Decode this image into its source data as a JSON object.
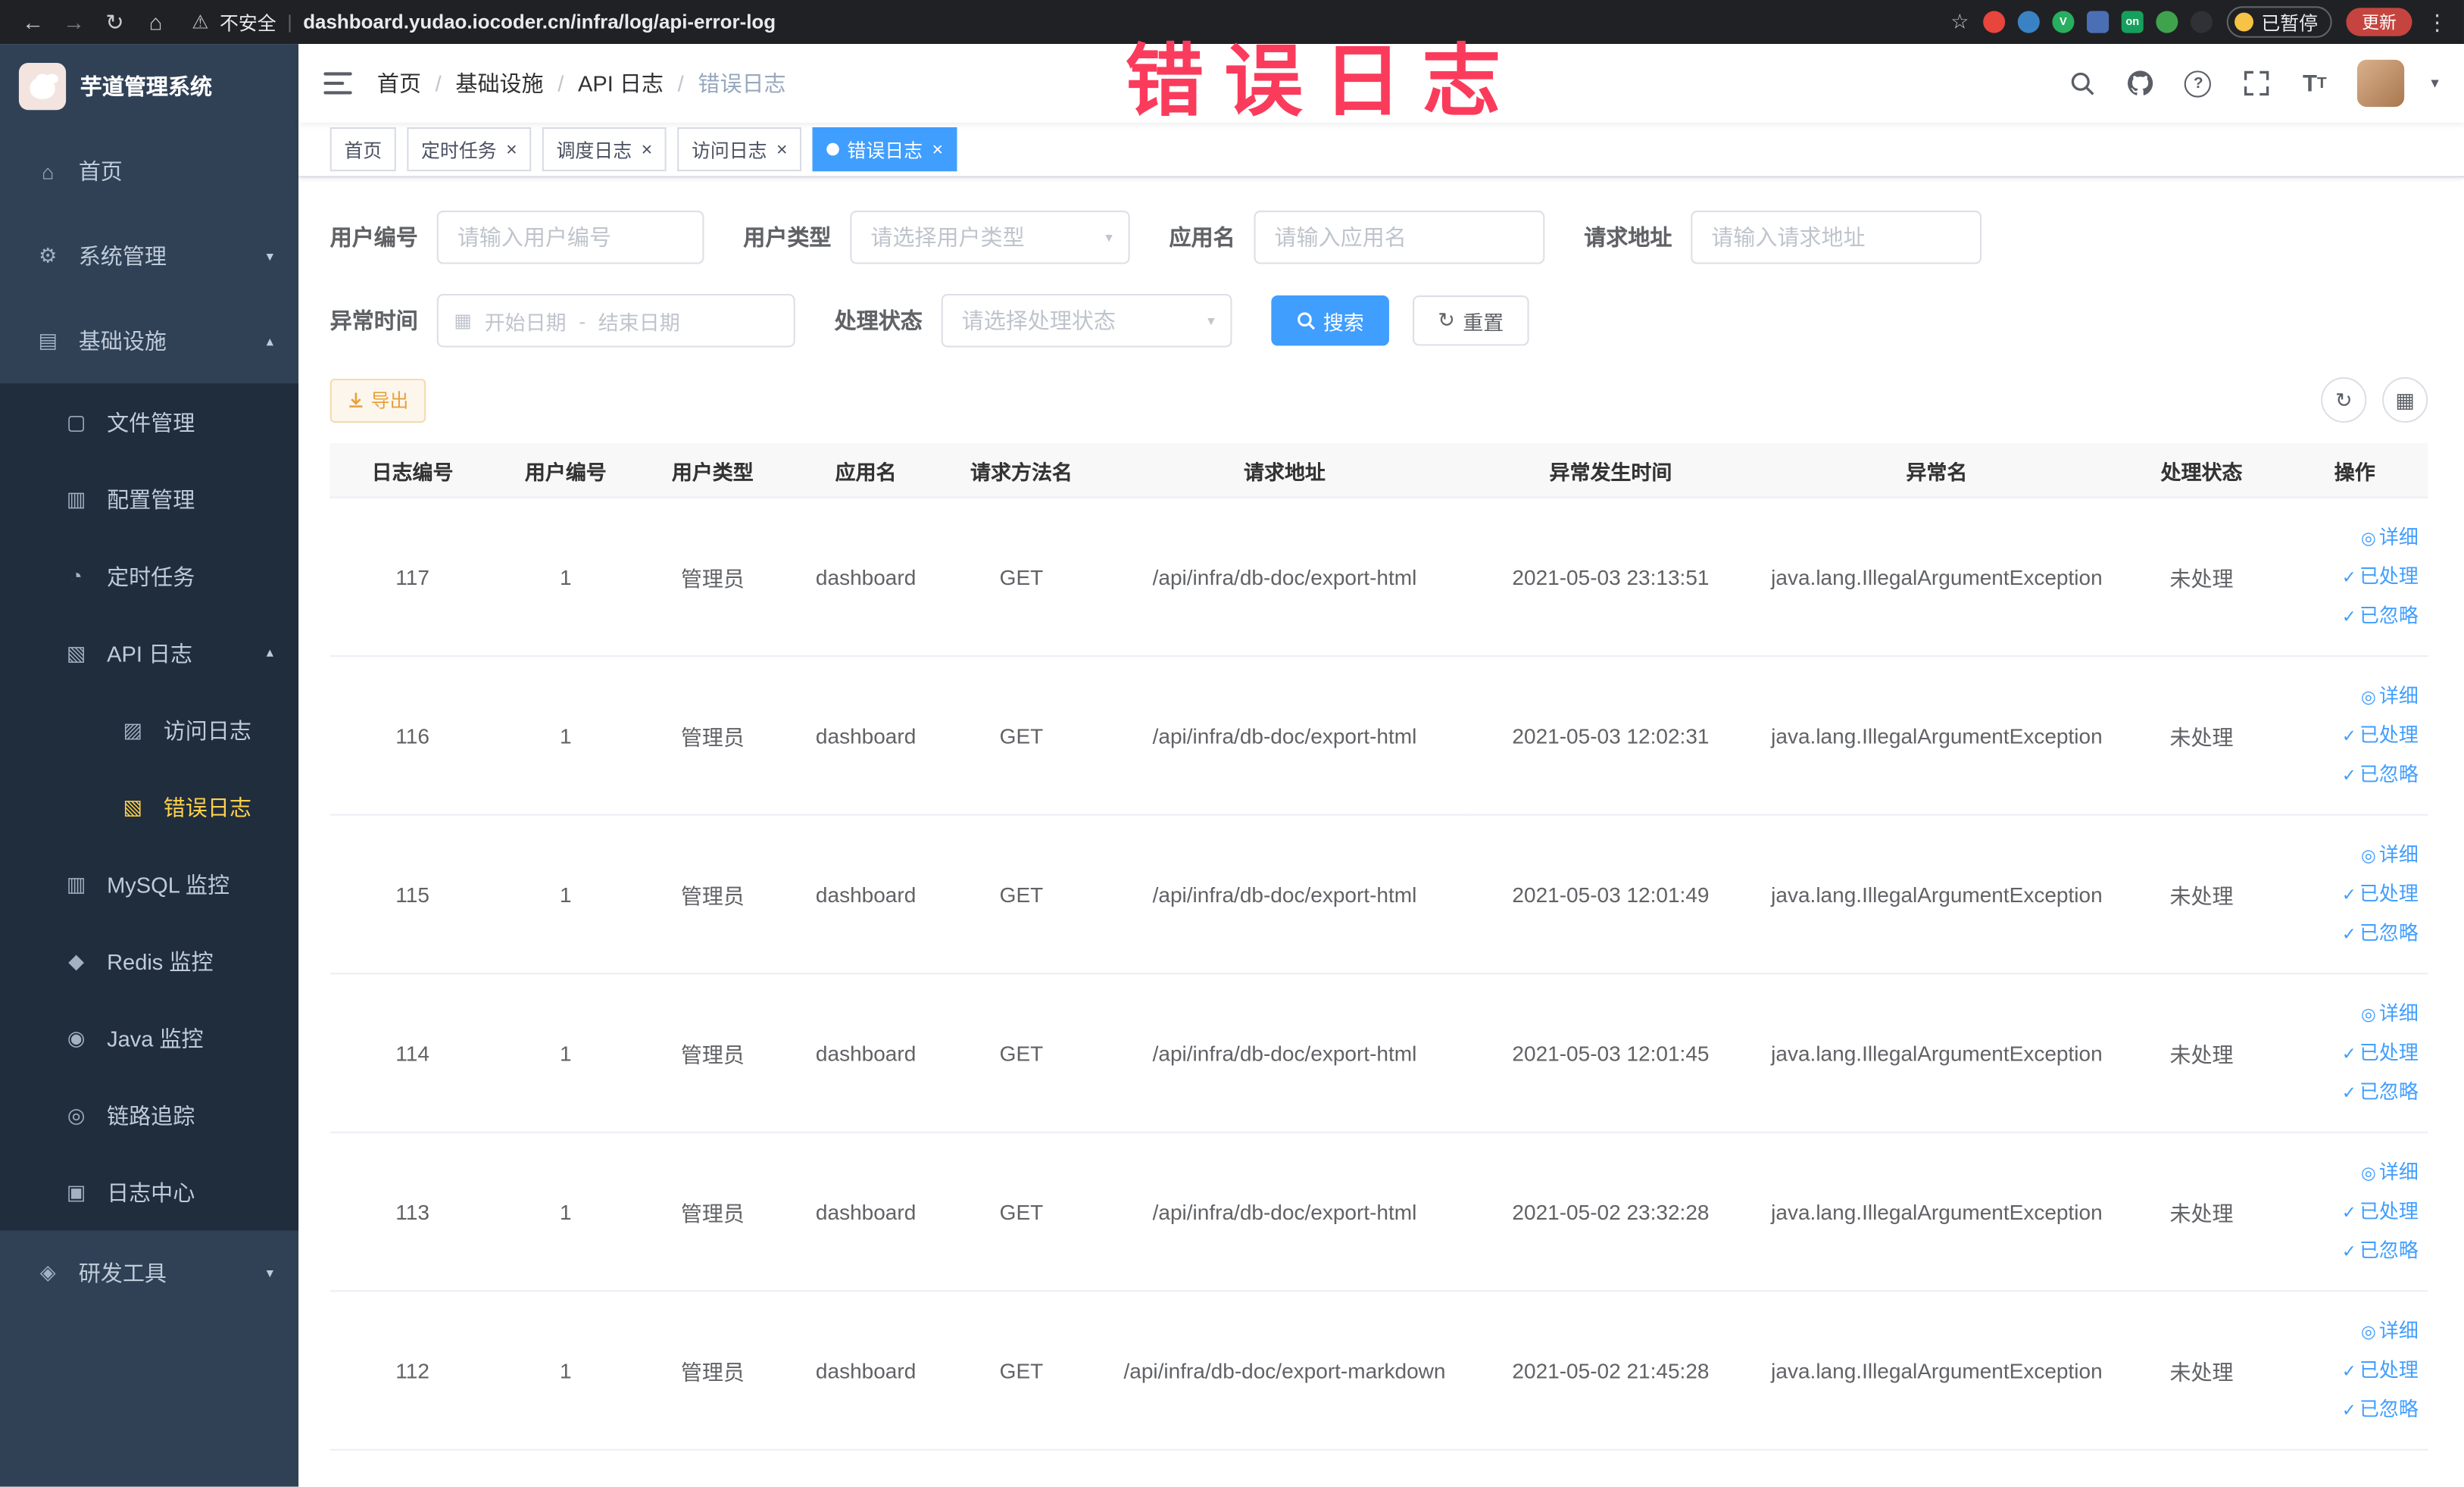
{
  "browser": {
    "security_label": "不安全",
    "url": "dashboard.yudao.iocoder.cn/infra/log/api-error-log",
    "paused_badge": "已暂停",
    "update_button": "更新",
    "extensions": [
      {
        "name": "extension-red-icon",
        "color": "#e8453c",
        "shape": "circle",
        "letter": ""
      },
      {
        "name": "extension-blue-drop-icon",
        "color": "#3b82c4",
        "shape": "circle",
        "letter": ""
      },
      {
        "name": "extension-green-v-icon",
        "color": "#27ae60",
        "shape": "circle",
        "letter": "V"
      },
      {
        "name": "extension-grid-icon",
        "color": "#4b6fb5",
        "shape": "square",
        "letter": ""
      },
      {
        "name": "extension-on-badge-icon",
        "color": "#16a05d",
        "shape": "square",
        "letter": "on"
      },
      {
        "name": "extension-leaf-icon",
        "color": "#3fa34d",
        "shape": "circle",
        "letter": ""
      },
      {
        "name": "extension-paw-icon",
        "color": "#2f3136",
        "shape": "circle",
        "letter": ""
      }
    ]
  },
  "overlay": {
    "text": "错误日志",
    "color": "#fb3b5c"
  },
  "icons": {
    "back": "←",
    "forward": "→",
    "reload": "↻",
    "home": "⌂",
    "warning": "⚠",
    "star": "☆",
    "more": "⋮",
    "close": "×",
    "chevron_down": "▾",
    "chevron_up": "▴",
    "caret": "▾",
    "check": "✓",
    "view": "◎",
    "refresh": "↻",
    "grid": "▦",
    "calendar": "▦",
    "breadcrumb_sep": "/",
    "url_sep": "|",
    "download": "↓"
  },
  "sidebar": {
    "title": "芋道管理系统",
    "items": [
      {
        "label": "首页",
        "icon": "home-icon",
        "glyph": "⌂",
        "level": 1,
        "chevron": ""
      },
      {
        "label": "系统管理",
        "icon": "system-gear-icon",
        "glyph": "⚙",
        "level": 1,
        "chevron": "down"
      },
      {
        "label": "基础设施",
        "icon": "infrastructure-icon",
        "glyph": "▤",
        "level": 1,
        "chevron": "up"
      },
      {
        "label": "文件管理",
        "icon": "file-manage-icon",
        "glyph": "▢",
        "level": 2,
        "chevron": ""
      },
      {
        "label": "配置管理",
        "icon": "config-manage-icon",
        "glyph": "▥",
        "level": 2,
        "chevron": ""
      },
      {
        "label": "定时任务",
        "icon": "scheduled-job-icon",
        "glyph": "◔",
        "level": 2,
        "chevron": ""
      },
      {
        "label": "API 日志",
        "icon": "api-log-icon",
        "glyph": "▧",
        "level": 2,
        "chevron": "up"
      },
      {
        "label": "访问日志",
        "icon": "access-log-icon",
        "glyph": "▨",
        "level": 3,
        "chevron": ""
      },
      {
        "label": "错误日志",
        "icon": "error-log-icon",
        "glyph": "▧",
        "level": 3,
        "chevron": "",
        "active": true
      },
      {
        "label": "MySQL 监控",
        "icon": "mysql-monitor-icon",
        "glyph": "▥",
        "level": 2,
        "chevron": ""
      },
      {
        "label": "Redis 监控",
        "icon": "redis-monitor-icon",
        "glyph": "◆",
        "level": 2,
        "chevron": ""
      },
      {
        "label": "Java 监控",
        "icon": "java-monitor-icon",
        "glyph": "◉",
        "level": 2,
        "chevron": ""
      },
      {
        "label": "链路追踪",
        "icon": "trace-icon",
        "glyph": "◎",
        "level": 2,
        "chevron": ""
      },
      {
        "label": "日志中心",
        "icon": "log-center-icon",
        "glyph": "▣",
        "level": 2,
        "chevron": ""
      },
      {
        "label": "研发工具",
        "icon": "dev-tools-icon",
        "glyph": "◈",
        "level": 1,
        "chevron": "down"
      }
    ]
  },
  "breadcrumb": [
    "首页",
    "基础设施",
    "API 日志",
    "错误日志"
  ],
  "tabs": [
    {
      "label": "首页",
      "closable": false,
      "active": false
    },
    {
      "label": "定时任务",
      "closable": true,
      "active": false
    },
    {
      "label": "调度日志",
      "closable": true,
      "active": false
    },
    {
      "label": "访问日志",
      "closable": true,
      "active": false
    },
    {
      "label": "错误日志",
      "closable": true,
      "active": true
    }
  ],
  "filters": {
    "user_id": {
      "label": "用户编号",
      "placeholder": "请输入用户编号"
    },
    "user_type": {
      "label": "用户类型",
      "placeholder": "请选择用户类型"
    },
    "app_name": {
      "label": "应用名",
      "placeholder": "请输入应用名"
    },
    "request_url": {
      "label": "请求地址",
      "placeholder": "请输入请求地址"
    },
    "exception_time": {
      "label": "异常时间",
      "start_placeholder": "开始日期",
      "separator": "-",
      "end_placeholder": "结束日期"
    },
    "process_status": {
      "label": "处理状态",
      "placeholder": "请选择处理状态"
    },
    "search_button": "搜索",
    "reset_button": "重置"
  },
  "toolbar": {
    "export_button": "导出"
  },
  "table": {
    "columns": [
      "日志编号",
      "用户编号",
      "用户类型",
      "应用名",
      "请求方法名",
      "请求地址",
      "异常发生时间",
      "异常名",
      "处理状态",
      "操作"
    ],
    "actions": [
      {
        "label": "详细",
        "icon": "view"
      },
      {
        "label": "已处理",
        "icon": "check"
      },
      {
        "label": "已忽略",
        "icon": "check"
      }
    ],
    "rows": [
      {
        "id": "117",
        "user_id": "1",
        "user_type": "管理员",
        "app": "dashboard",
        "method": "GET",
        "url": "/api/infra/db-doc/export-html",
        "time": "2021-05-03 23:13:51",
        "exception": "java.lang.IllegalArgumentException",
        "status": "未处理"
      },
      {
        "id": "116",
        "user_id": "1",
        "user_type": "管理员",
        "app": "dashboard",
        "method": "GET",
        "url": "/api/infra/db-doc/export-html",
        "time": "2021-05-03 12:02:31",
        "exception": "java.lang.IllegalArgumentException",
        "status": "未处理"
      },
      {
        "id": "115",
        "user_id": "1",
        "user_type": "管理员",
        "app": "dashboard",
        "method": "GET",
        "url": "/api/infra/db-doc/export-html",
        "time": "2021-05-03 12:01:49",
        "exception": "java.lang.IllegalArgumentException",
        "status": "未处理"
      },
      {
        "id": "114",
        "user_id": "1",
        "user_type": "管理员",
        "app": "dashboard",
        "method": "GET",
        "url": "/api/infra/db-doc/export-html",
        "time": "2021-05-03 12:01:45",
        "exception": "java.lang.IllegalArgumentException",
        "status": "未处理"
      },
      {
        "id": "113",
        "user_id": "1",
        "user_type": "管理员",
        "app": "dashboard",
        "method": "GET",
        "url": "/api/infra/db-doc/export-html",
        "time": "2021-05-02 23:32:28",
        "exception": "java.lang.IllegalArgumentException",
        "status": "未处理"
      },
      {
        "id": "112",
        "user_id": "1",
        "user_type": "管理员",
        "app": "dashboard",
        "method": "GET",
        "url": "/api/infra/db-doc/export-markdown",
        "time": "2021-05-02 21:45:28",
        "exception": "java.lang.IllegalArgumentException",
        "status": "未处理"
      }
    ]
  }
}
